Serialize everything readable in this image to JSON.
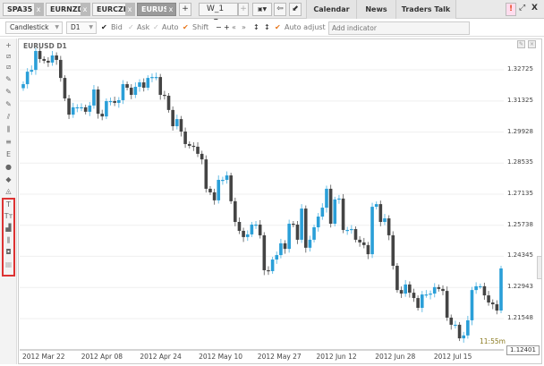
{
  "tabs": [
    {
      "label": "SPA35"
    },
    {
      "label": "EURNZD"
    },
    {
      "label": "EURCZK"
    },
    {
      "label": "EURUSD"
    }
  ],
  "add_tab": "+",
  "workspace": {
    "value": "W_1",
    "add": "+"
  },
  "nav_tabs": [
    "Calendar",
    "News",
    "Traders Talk"
  ],
  "window_controls": {
    "alert": "!",
    "expand": "⤢",
    "close": "X"
  },
  "toolbar": {
    "chart_type": "Candlestick",
    "timeframe": "D1",
    "bid": "Bid",
    "ask": "Ask",
    "auto": "Auto",
    "shift": "Shift",
    "auto_adjust": "Auto adjust",
    "indicator_placeholder": "Add indicator"
  },
  "chart_title": "EURUSD D1",
  "colors": {
    "up": "#2a9fd8",
    "down": "#444444",
    "alert": "#e84a2a",
    "highlight": "#d33333"
  },
  "countdown": "11:55m",
  "current_price_tag": "1.12401",
  "chart_data": {
    "type": "candlestick",
    "title": "EURUSD D1",
    "y_ticks": [
      "1.32725",
      "1.31325",
      "1.29928",
      "1.28535",
      "1.27135",
      "1.25738",
      "1.24345",
      "1.22943",
      "1.21548"
    ],
    "y_tick_values": [
      1.32725,
      1.31325,
      1.29928,
      1.28535,
      1.27135,
      1.25738,
      1.24345,
      1.22943,
      1.21548
    ],
    "x_ticks": [
      "2012 Mar 22",
      "2012 Apr 08",
      "2012 Apr 24",
      "2012 May 10",
      "2012 May 27",
      "2012 Jun 12",
      "2012 Jun 28",
      "2012 Jul 15"
    ],
    "first_open": 1.319,
    "closes": [
      1.3208,
      1.3264,
      1.3272,
      1.3357,
      1.3321,
      1.3313,
      1.3305,
      1.3337,
      1.3317,
      1.3236,
      1.3144,
      1.3071,
      1.3104,
      1.3104,
      1.3104,
      1.3084,
      1.3112,
      1.3184,
      1.3075,
      1.3063,
      1.3132,
      1.3132,
      1.3124,
      1.3136,
      1.3208,
      1.3192,
      1.316,
      1.3196,
      1.3216,
      1.3192,
      1.3236,
      1.324,
      1.324,
      1.316,
      1.3156,
      1.3092,
      1.3019,
      1.3051,
      1.2995,
      1.2939,
      1.2931,
      1.2927,
      1.2895,
      1.287,
      1.2738,
      1.2722,
      1.2686,
      1.2778,
      1.2778,
      1.2798,
      1.2682,
      1.2589,
      1.2549,
      1.2521,
      1.2533,
      1.2577,
      1.2577,
      1.2529,
      1.2372,
      1.2368,
      1.242,
      1.244,
      1.2493,
      1.2468,
      1.2581,
      1.2577,
      1.2509,
      1.2649,
      1.2473,
      1.2509,
      1.2565,
      1.2613,
      1.2653,
      1.2738,
      1.2581,
      1.269,
      1.2694,
      1.2553,
      1.2553,
      1.2557,
      1.2509,
      1.2497,
      1.2485,
      1.2444,
      1.2657,
      1.2669,
      1.2589,
      1.2605,
      1.2529,
      1.2392,
      1.2283,
      1.2267,
      1.2308,
      1.2271,
      1.2247,
      1.2203,
      1.2263,
      1.2263,
      1.2267,
      1.2296,
      1.2288,
      1.2279,
      1.2159,
      1.2127,
      1.2127,
      1.2066,
      1.2079,
      1.2147,
      1.2283,
      1.23,
      1.23,
      1.2259,
      1.2227,
      1.2219,
      1.2191,
      1.238
    ]
  }
}
